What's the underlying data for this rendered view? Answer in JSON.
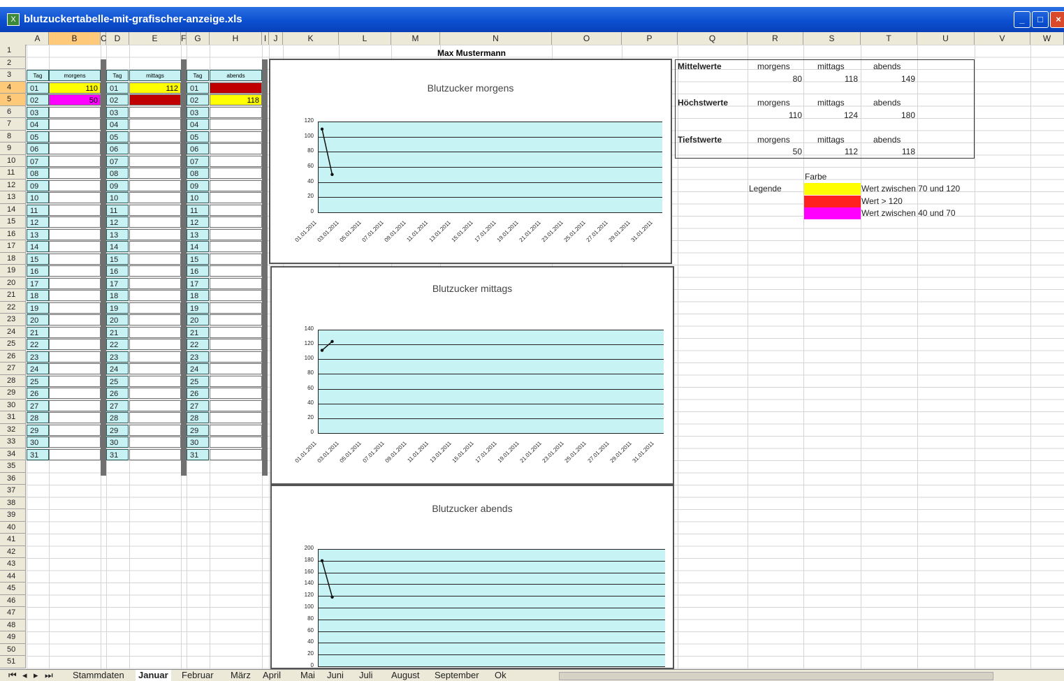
{
  "window": {
    "title": "blutzuckertabelle-mit-grafischer-anzeige.xls"
  },
  "columns": [
    "A",
    "B",
    "C",
    "D",
    "E",
    "F",
    "G",
    "H",
    "I",
    "J",
    "K",
    "L",
    "M",
    "N",
    "O",
    "P",
    "Q",
    "R",
    "S",
    "T",
    "U",
    "V",
    "W"
  ],
  "rows_count": 51,
  "sheet_title": "Max Mustermann",
  "table": {
    "headers": {
      "tag": "Tag",
      "morgens": "morgens",
      "mittags": "mittags",
      "abends": "abends"
    },
    "days": [
      "01",
      "02",
      "03",
      "04",
      "05",
      "06",
      "07",
      "08",
      "09",
      "10",
      "11",
      "12",
      "13",
      "14",
      "15",
      "16",
      "17",
      "18",
      "19",
      "20",
      "21",
      "22",
      "23",
      "24",
      "25",
      "26",
      "27",
      "28",
      "29",
      "30",
      "31"
    ],
    "morgens_values": {
      "01": "110",
      "02": "50"
    },
    "mittags_values": {
      "01": "112",
      "02": "124"
    },
    "abends_values": {
      "01": "180",
      "02": "118"
    },
    "colors": {
      "yellow": "#ffff00",
      "red": "#c00000",
      "magenta": "#ff00ff"
    }
  },
  "stats": {
    "mittelwerte": {
      "label": "Mittelwerte",
      "morgens_label": "morgens",
      "mittags_label": "mittags",
      "abends_label": "abends",
      "morgens": "80",
      "mittags": "118",
      "abends": "149"
    },
    "hoechstwerte": {
      "label": "Höchstwerte",
      "morgens_label": "morgens",
      "mittags_label": "mittags",
      "abends_label": "abends",
      "morgens": "110",
      "mittags": "124",
      "abends": "180"
    },
    "tiefstwerte": {
      "label": "Tiefstwerte",
      "morgens_label": "morgens",
      "mittags_label": "mittags",
      "abends_label": "abends",
      "morgens": "50",
      "mittags": "112",
      "abends": "118"
    }
  },
  "legend": {
    "farbe": "Farbe",
    "legende": "Legende",
    "items": [
      {
        "color": "#ffff00",
        "text": "Wert zwischen 70 und 120"
      },
      {
        "color": "#ff2020",
        "text": "Wert > 120"
      },
      {
        "color": "#ff00ff",
        "text": "Wert zwischen 40 und 70"
      }
    ]
  },
  "chart_data": [
    {
      "type": "line",
      "title": "Blutzucker morgens",
      "x": [
        "01.01.2011",
        "02.01.2011"
      ],
      "values": [
        110,
        50
      ],
      "ylim": [
        0,
        120
      ],
      "yticks": [
        0,
        20,
        40,
        60,
        80,
        100,
        120
      ],
      "xticks": [
        "01.01.2011",
        "03.01.2011",
        "05.01.2011",
        "07.01.2011",
        "09.01.2011",
        "11.01.2011",
        "13.01.2011",
        "15.01.2011",
        "17.01.2011",
        "19.01.2011",
        "21.01.2011",
        "23.01.2011",
        "25.01.2011",
        "27.01.2011",
        "29.01.2011",
        "31.01.2011"
      ],
      "background": "#c7f3f5"
    },
    {
      "type": "line",
      "title": "Blutzucker mittags",
      "x": [
        "01.01.2011",
        "02.01.2011"
      ],
      "values": [
        112,
        124
      ],
      "ylim": [
        0,
        140
      ],
      "yticks": [
        0,
        20,
        40,
        60,
        80,
        100,
        120,
        140
      ],
      "xticks": [
        "01.01.2011",
        "03.01.2011",
        "05.01.2011",
        "07.01.2011",
        "09.01.2011",
        "11.01.2011",
        "13.01.2011",
        "15.01.2011",
        "17.01.2011",
        "19.01.2011",
        "21.01.2011",
        "23.01.2011",
        "25.01.2011",
        "27.01.2011",
        "29.01.2011",
        "31.01.2011"
      ],
      "background": "#c7f3f5"
    },
    {
      "type": "line",
      "title": "Blutzucker abends",
      "x": [
        "01.01.2011",
        "02.01.2011"
      ],
      "values": [
        180,
        118
      ],
      "ylim": [
        0,
        200
      ],
      "yticks": [
        0,
        20,
        40,
        60,
        80,
        100,
        120,
        140,
        160,
        180,
        200
      ],
      "background": "#c7f3f5"
    }
  ],
  "sheet_tabs": [
    "Stammdaten",
    "Januar",
    "Februar",
    "März",
    "April",
    "Mai",
    "Juni",
    "Juli",
    "August",
    "September",
    "Ok"
  ],
  "active_tab": "Januar"
}
